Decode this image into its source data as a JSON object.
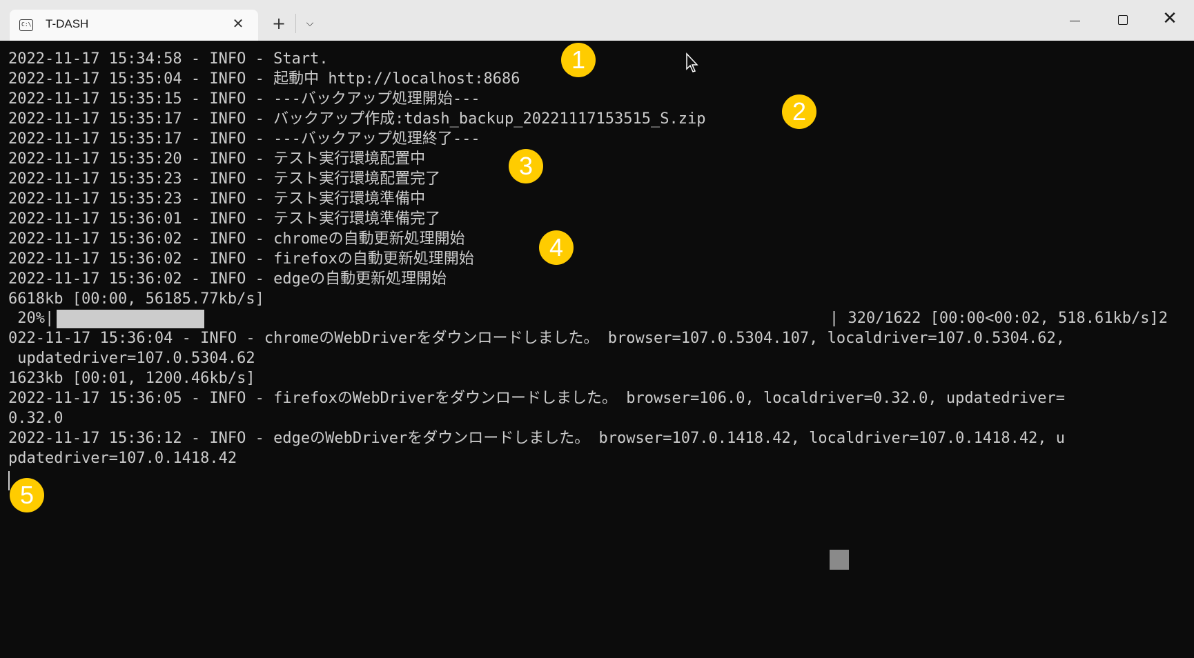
{
  "window": {
    "tab_title": "T-DASH",
    "tab_icon": "terminal-icon",
    "new_tab_glyph": "+",
    "dropdown_glyph": "⌵",
    "close_tab_glyph": "✕",
    "close_window_glyph": "✕"
  },
  "terminal": {
    "lines": [
      "2022-11-17 15:34:58 - INFO - Start.",
      "2022-11-17 15:35:04 - INFO - 起動中 http://localhost:8686",
      "2022-11-17 15:35:15 - INFO - ---バックアップ処理開始---",
      "2022-11-17 15:35:17 - INFO - バックアップ作成:tdash_backup_20221117153515_S.zip",
      "2022-11-17 15:35:17 - INFO - ---バックアップ処理終了---",
      "2022-11-17 15:35:20 - INFO - テスト実行環境配置中",
      "2022-11-17 15:35:23 - INFO - テスト実行環境配置完了",
      "2022-11-17 15:35:23 - INFO - テスト実行環境準備中",
      "2022-11-17 15:36:01 - INFO - テスト実行環境準備完了",
      "2022-11-17 15:36:02 - INFO - chromeの自動更新処理開始",
      "2022-11-17 15:36:02 - INFO - firefoxの自動更新処理開始",
      "2022-11-17 15:36:02 - INFO - edgeの自動更新処理開始",
      "6618kb [00:00, 56185.77kb/s]"
    ],
    "progress": {
      "left": " 20%|",
      "fraction": 0.2,
      "right": "| 320/1622 [00:00<00:02, 518.61kb/s]2"
    },
    "lines_after": [
      "022-11-17 15:36:04 - INFO - chromeのWebDriverをダウンロードしました。 browser=107.0.5304.107, localdriver=107.0.5304.62,",
      " updatedriver=107.0.5304.62",
      "1623kb [00:01, 1200.46kb/s]",
      "2022-11-17 15:36:05 - INFO - firefoxのWebDriverをダウンロードしました。 browser=106.0, localdriver=0.32.0, updatedriver=",
      "0.32.0",
      "2022-11-17 15:36:12 - INFO - edgeのWebDriverをダウンロードしました。 browser=107.0.1418.42, localdriver=107.0.1418.42, u",
      "pdatedriver=107.0.1418.42"
    ]
  },
  "annotations": [
    "1",
    "2",
    "3",
    "4",
    "5"
  ],
  "colors": {
    "terminal_bg": "#0c0c0c",
    "terminal_fg": "#cccccc",
    "badge": "#ffcc00",
    "titlebar": "#e8e8e8"
  }
}
